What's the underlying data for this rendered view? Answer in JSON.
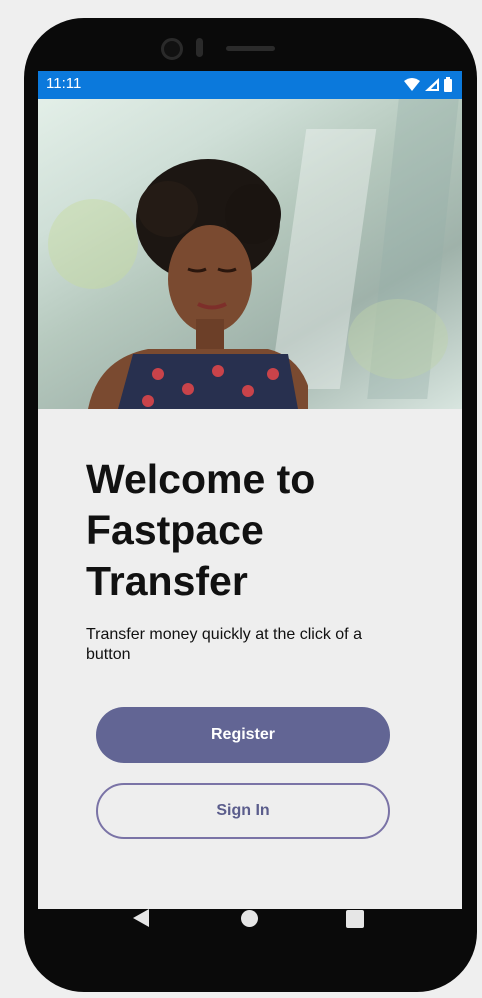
{
  "status_bar": {
    "time": "11:11",
    "icons": [
      "wifi-icon",
      "signal-icon",
      "battery-icon"
    ],
    "background": "#0b79dc"
  },
  "welcome": {
    "title": "Welcome to\nFastpace\nTransfer",
    "subtitle": "Transfer money quickly at the click of a button"
  },
  "actions": {
    "register_label": "Register",
    "signin_label": "Sign In"
  },
  "nav_bar": {
    "icons": [
      "back-icon",
      "home-icon",
      "recent-apps-icon"
    ]
  },
  "colors": {
    "primary": "#626594",
    "outline": "#7a73a6",
    "card_background": "#eeeeee"
  }
}
